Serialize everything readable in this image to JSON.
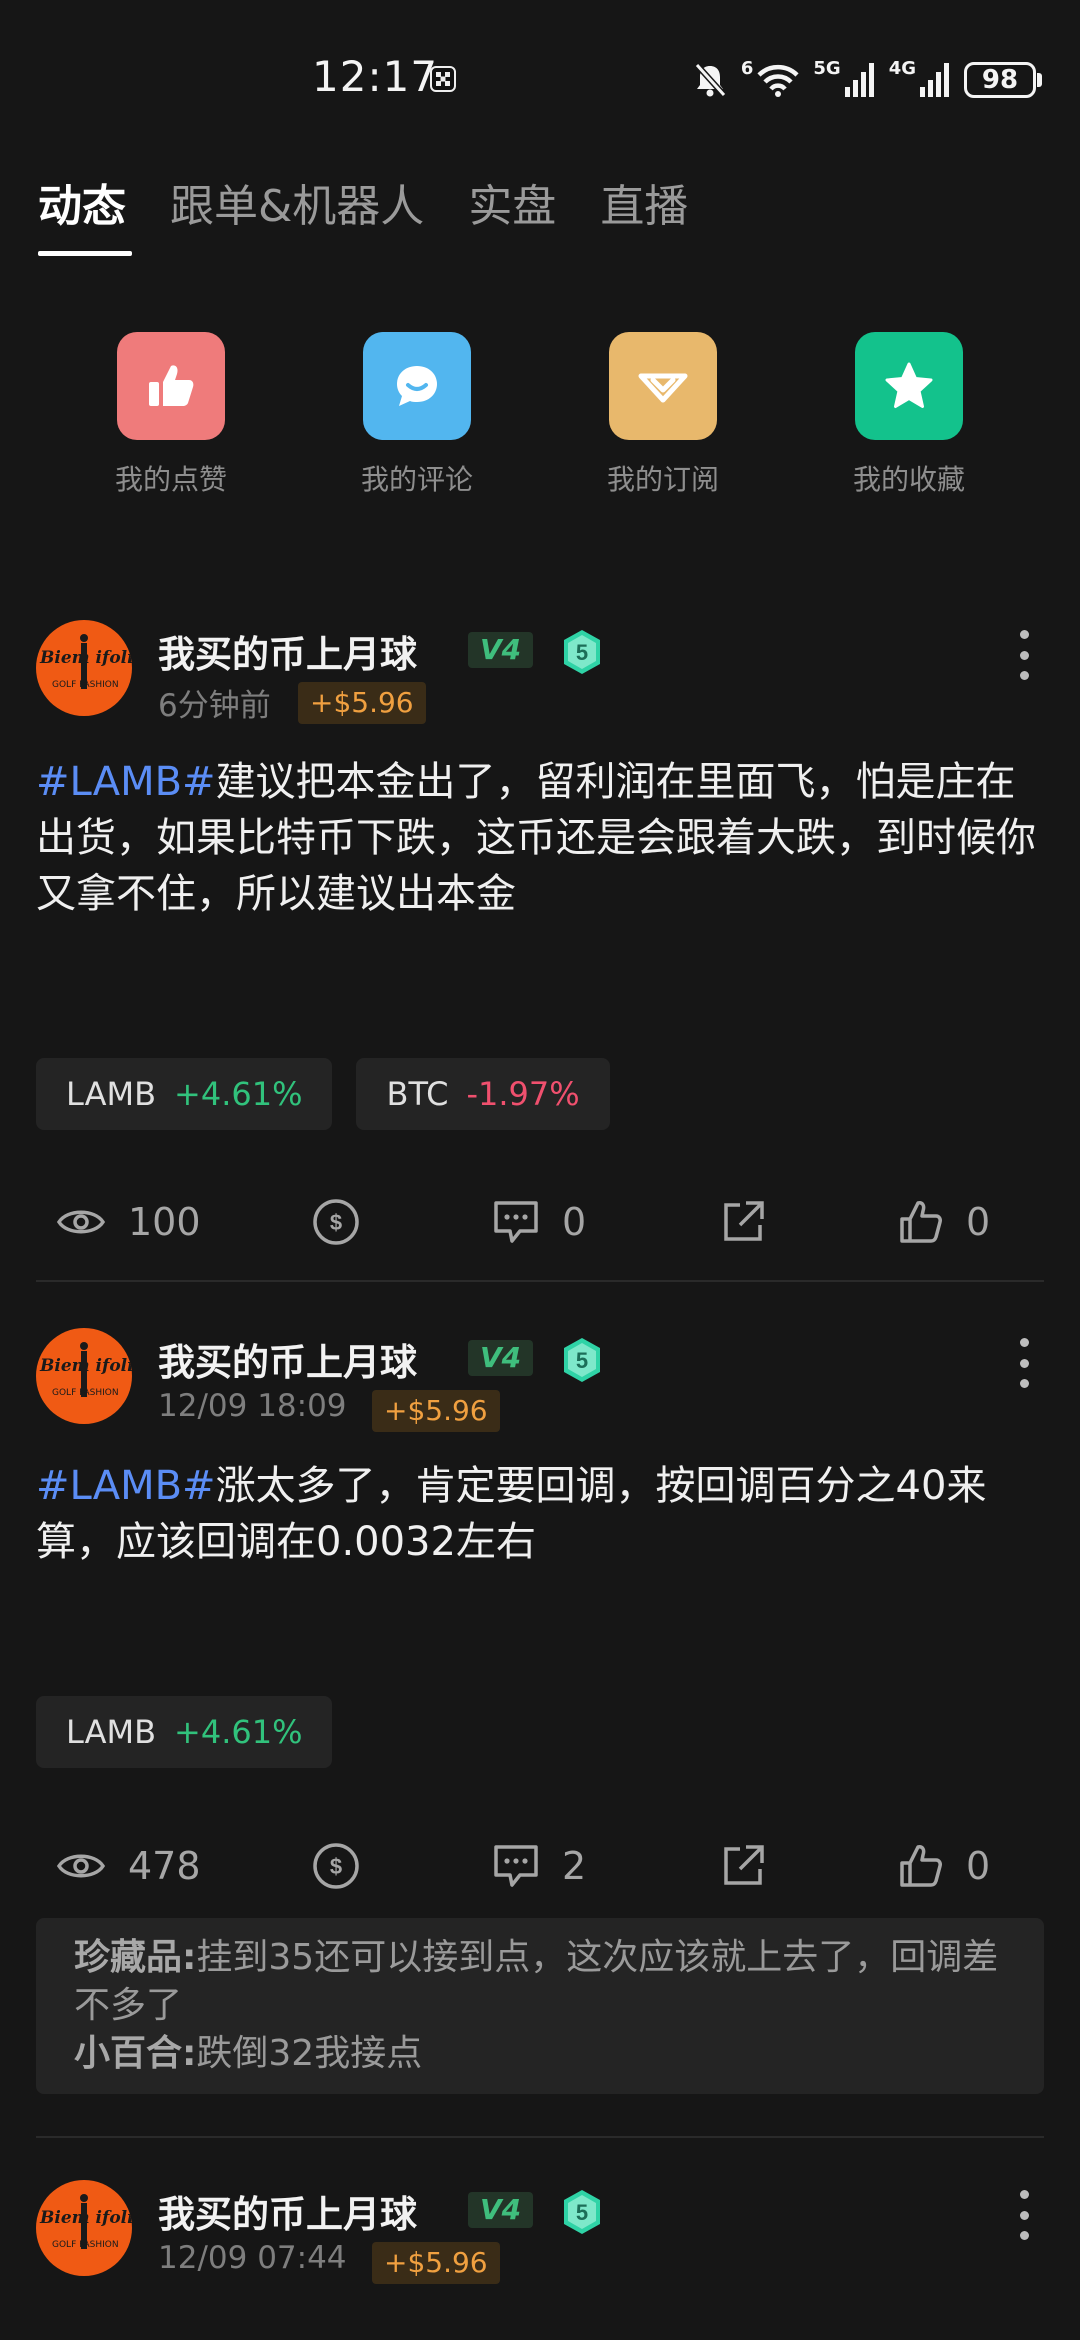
{
  "status_bar": {
    "time": "12:17",
    "wifi_sup": "6",
    "net1": "5G",
    "net2": "4G",
    "battery": "98"
  },
  "tabs": [
    {
      "label": "动态",
      "active": true
    },
    {
      "label": "跟单&机器人",
      "active": false
    },
    {
      "label": "实盘",
      "active": false
    },
    {
      "label": "直播",
      "active": false
    }
  ],
  "quick_actions": [
    {
      "label": "我的点赞",
      "icon": "thumb-up-icon",
      "color": "#ef7b7b"
    },
    {
      "label": "我的评论",
      "icon": "comment-icon",
      "color": "#52b6ef"
    },
    {
      "label": "我的订阅",
      "icon": "subscribe-icon",
      "color": "#e8b86c"
    },
    {
      "label": "我的收藏",
      "icon": "star-icon",
      "color": "#13c28c"
    }
  ],
  "posts": [
    {
      "username": "我买的币上月球",
      "vip": "V4",
      "level": "5",
      "time": "6分钟前",
      "earning": "+$5.96",
      "tag": "#LAMB#",
      "text": "建议把本金出了，留利润在里面飞，怕是庄在出货，如果比特币下跌，这币还是会跟着大跌，到时候你又拿不住，所以建议出本金",
      "coins": [
        {
          "symbol": "LAMB",
          "change": "+4.61%"
        },
        {
          "symbol": "BTC",
          "change": "-1.97%"
        }
      ],
      "views": "100",
      "comments": "0",
      "likes": "0"
    },
    {
      "username": "我买的币上月球",
      "vip": "V4",
      "level": "5",
      "time": "12/09 18:09",
      "earning": "+$5.96",
      "tag": "#LAMB#",
      "text": "涨太多了，肯定要回调，按回调百分之40来算，应该回调在0.0032左右",
      "coins": [
        {
          "symbol": "LAMB",
          "change": "+4.61%"
        }
      ],
      "views": "478",
      "comments": "2",
      "likes": "0",
      "replies": [
        {
          "user": "珍藏品:",
          "text": "挂到35还可以接到点，这次应该就上去了，回调差不多了"
        },
        {
          "user": "小百合:",
          "text": "跌倒32我接点"
        }
      ]
    },
    {
      "username": "我买的币上月球",
      "vip": "V4",
      "level": "5",
      "time": "12/09 07:44",
      "earning": "+$5.96"
    }
  ],
  "colors": {
    "background": "#161616",
    "tag": "#5b8df5",
    "up": "#31c27c",
    "down": "#f0506e",
    "earning": "#f0a040"
  }
}
